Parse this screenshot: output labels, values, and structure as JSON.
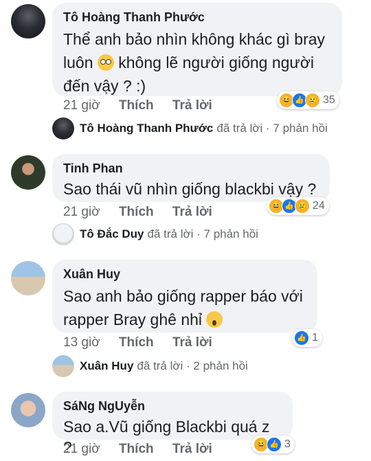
{
  "comments": [
    {
      "author": "Tô Hoàng Thanh Phước",
      "text_line1": "Thể anh bảo nhìn không khác gì bray",
      "text_line2a": "luôn",
      "text_line2b": "không lẽ người giống người",
      "text_line3": "đến vậy ? :)",
      "time": "21 giờ",
      "like": "Thích",
      "reply": "Trả lời",
      "reaction_count": "35",
      "reply_summary": {
        "name": "Tô Hoàng Thanh Phước",
        "text": "đã trả lời · 7 phản hồi"
      }
    },
    {
      "author": "Tinh Phan",
      "text_line1": "Sao thái vũ nhìn giống blackbi vậy ?",
      "time": "21 giờ",
      "like": "Thích",
      "reply": "Trả lời",
      "reaction_count": "24",
      "reply_summary": {
        "name": "Tô Đắc Duy",
        "text": "đã trả lời · 7 phản hồi"
      }
    },
    {
      "author": "Xuân Huy",
      "text_line1": "Sao anh bảo giống rapper báo với",
      "text_line2": "rapper Bray ghê nhỉ",
      "time": "13 giờ",
      "like": "Thích",
      "reply": "Trả lời",
      "reaction_count": "1",
      "reply_summary": {
        "name": "Xuân Huy",
        "text": "đã trả lời · 2 phản hồi"
      }
    },
    {
      "author": "SáNg NgUyễn",
      "text_line1": "Sao a.Vũ giống Blackbi quá z ?",
      "time": "21 giờ",
      "like": "Thích",
      "reply": "Trả lời",
      "reaction_count": "3"
    }
  ],
  "icons": {
    "haha": "😆",
    "like": "👍",
    "sad": "😢"
  }
}
